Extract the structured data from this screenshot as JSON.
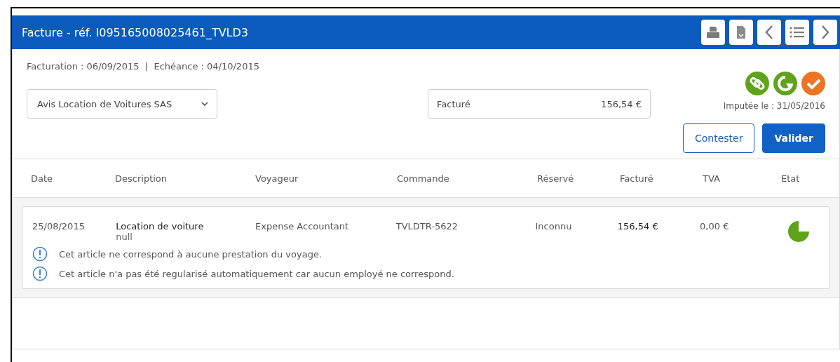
{
  "window": {
    "title": "Facture - réf. I095165008025461_TVLD3"
  },
  "toolbar": [
    {
      "kind": "print"
    },
    {
      "kind": "pdf"
    },
    {
      "kind": "prev"
    },
    {
      "kind": "list"
    },
    {
      "kind": "next"
    }
  ],
  "dates": {
    "billing": "Facturation : 06/09/2015",
    "separator": "|",
    "due": "Echéance : 04/10/2015"
  },
  "supplier": {
    "value": "Avis Location de Voitures SAS"
  },
  "invoiced_field": {
    "label": "Facturé",
    "value": "156,54 €"
  },
  "status_icons": [
    {
      "kind": "link",
      "color": "#5fa319"
    },
    {
      "kind": "partial",
      "color": "#5fa319"
    },
    {
      "kind": "check",
      "color": "#ec7423"
    }
  ],
  "imputed": "Imputée le : 31/05/2016",
  "buttons": [
    {
      "label": "Contester",
      "kind": "secondary"
    },
    {
      "label": "Valider",
      "kind": "primary"
    }
  ],
  "table": {
    "columns": [
      "Date",
      "Description",
      "Voyageur",
      "Commande",
      "Réservé",
      "Facturé",
      "TVA",
      "Etat"
    ],
    "rows": [
      {
        "date": "25/08/2015",
        "description": "Location de voiture",
        "subtitle": "null",
        "traveler": "Expense Accountant",
        "order": "TVLDTR-5622",
        "reserved": "Inconnu",
        "invoiced": "156,54 €",
        "vat": "0,00 €",
        "state_icon": {
          "kind": "partial"
        },
        "warnings": [
          "Cet article ne correspond à aucune prestation du voyage.",
          "Cet article n'a pas été regularisé automatiquement car aucun employé ne correspond."
        ]
      }
    ]
  }
}
